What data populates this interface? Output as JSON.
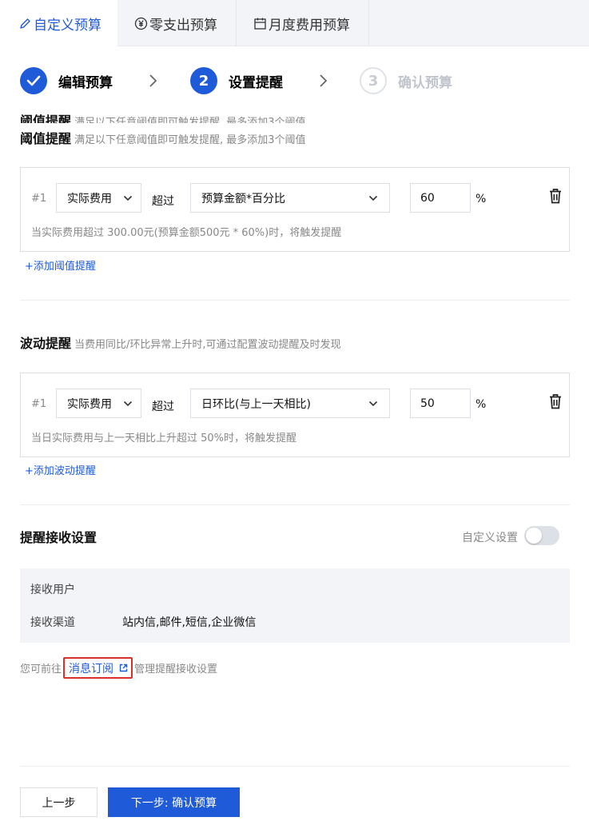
{
  "tabs": [
    {
      "label": "自定义预算",
      "icon": "pencil-icon",
      "active": true
    },
    {
      "label": "零支出预算",
      "icon": "yen-circle-icon",
      "active": false
    },
    {
      "label": "月度费用预算",
      "icon": "calendar-icon",
      "active": false
    }
  ],
  "steps": [
    {
      "number": "1",
      "label": "编辑预算",
      "state": "done"
    },
    {
      "number": "2",
      "label": "设置提醒",
      "state": "active"
    },
    {
      "number": "3",
      "label": "确认预算",
      "state": "pending"
    }
  ],
  "threshold": {
    "title": "阈值提醒",
    "desc": "满足以下任意阈值即可触发提醒, 最多添加3个阈值",
    "rule": {
      "index": "#1",
      "type": "实际费用",
      "over": "超过",
      "condition": "预算金额*百分比",
      "value": "60",
      "unit": "%",
      "hint": "当实际费用超过 300.00元(预算金额500元 * 60%)时，将触发提醒"
    },
    "add_label": "+添加阈值提醒"
  },
  "fluctuation": {
    "title": "波动提醒",
    "desc": "当费用同比/环比异常上升时,可通过配置波动提醒及时发现",
    "rule": {
      "index": "#1",
      "type": "实际费用",
      "over": "超过",
      "condition": "日环比(与上一天相比)",
      "value": "50",
      "unit": "%",
      "hint": "当日实际费用与上一天相比上升超过 50%时，将触发提醒"
    },
    "add_label": "+添加波动提醒"
  },
  "receive": {
    "title": "提醒接收设置",
    "toggle_label": "自定义设置",
    "toggle_on": false,
    "users_label": "接收用户",
    "users_value": "",
    "channels_label": "接收渠道",
    "channels_value": "站内信,邮件,短信,企业微信",
    "note_prefix": "您可前往",
    "note_link": "消息订阅",
    "note_suffix": "管理提醒接收设置"
  },
  "footer": {
    "prev_label": "上一步",
    "next_label": "下一步: 确认预算"
  },
  "colors": {
    "accent": "#1f5bd8",
    "highlight_border": "#d9302c"
  }
}
